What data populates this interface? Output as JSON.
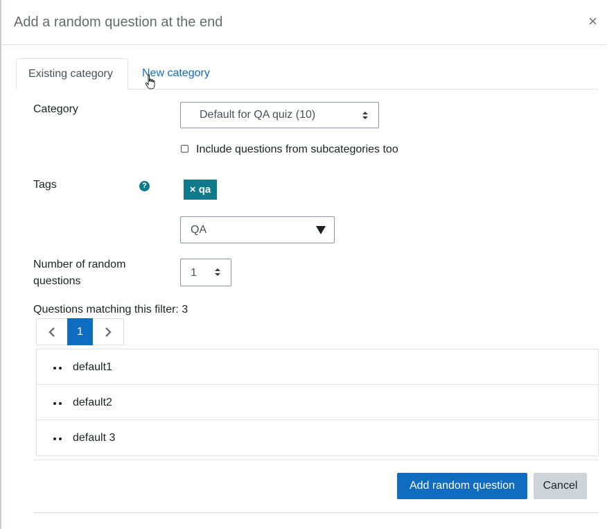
{
  "modal": {
    "title": "Add a random question at the end",
    "close_label": "×"
  },
  "tabs": [
    {
      "label": "Existing category",
      "active": true
    },
    {
      "label": "New category",
      "active": false
    }
  ],
  "form": {
    "category_label": "Category",
    "category_value": "Default for QA quiz (10)",
    "include_subcategories_label": "Include questions from subcategories too",
    "include_subcategories_checked": false,
    "tags_label": "Tags",
    "help_icon_glyph": "?",
    "selected_tag": "× qa",
    "tag_search_value": "QA",
    "number_label_line1": "Number of random",
    "number_label_line2": "questions",
    "number_value": "1",
    "matching_text": "Questions matching this filter: 3"
  },
  "pagination": {
    "current_page": "1"
  },
  "questions": [
    {
      "name": "default1"
    },
    {
      "name": "default2"
    },
    {
      "name": "default 3"
    }
  ],
  "footer": {
    "add_button_label": "Add random question",
    "cancel_button_label": "Cancel"
  },
  "colors": {
    "primary": "#0f6cbf",
    "tag_teal": "#0f7a8c",
    "secondary_button": "#ced4da"
  },
  "icons": {
    "close": "close-icon",
    "help": "question-circle-icon",
    "prev": "chevron-left-icon",
    "next": "chevron-right-icon",
    "select": "sort-updown-icon",
    "dropdown": "caret-down-icon"
  }
}
